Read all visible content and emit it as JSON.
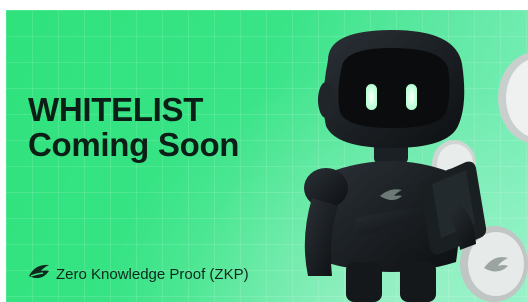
{
  "banner": {
    "headline_line1": "WHITELIST",
    "headline_line2": "Coming Soon",
    "brand_name": "Zero Knowledge Proof (ZKP)",
    "icons": {
      "brand_logo": "zkp-logo-icon",
      "coin": "zkp-coin-icon",
      "robot": "robot-mascot-illustration"
    },
    "colors": {
      "background_start": "#2fe27c",
      "background_end": "#86f1c0",
      "headline_text": "#0b1f16",
      "robot_body": "#15191c",
      "robot_eyes": "#d9ffe8",
      "coin_silver": "#dfe3e2"
    }
  }
}
